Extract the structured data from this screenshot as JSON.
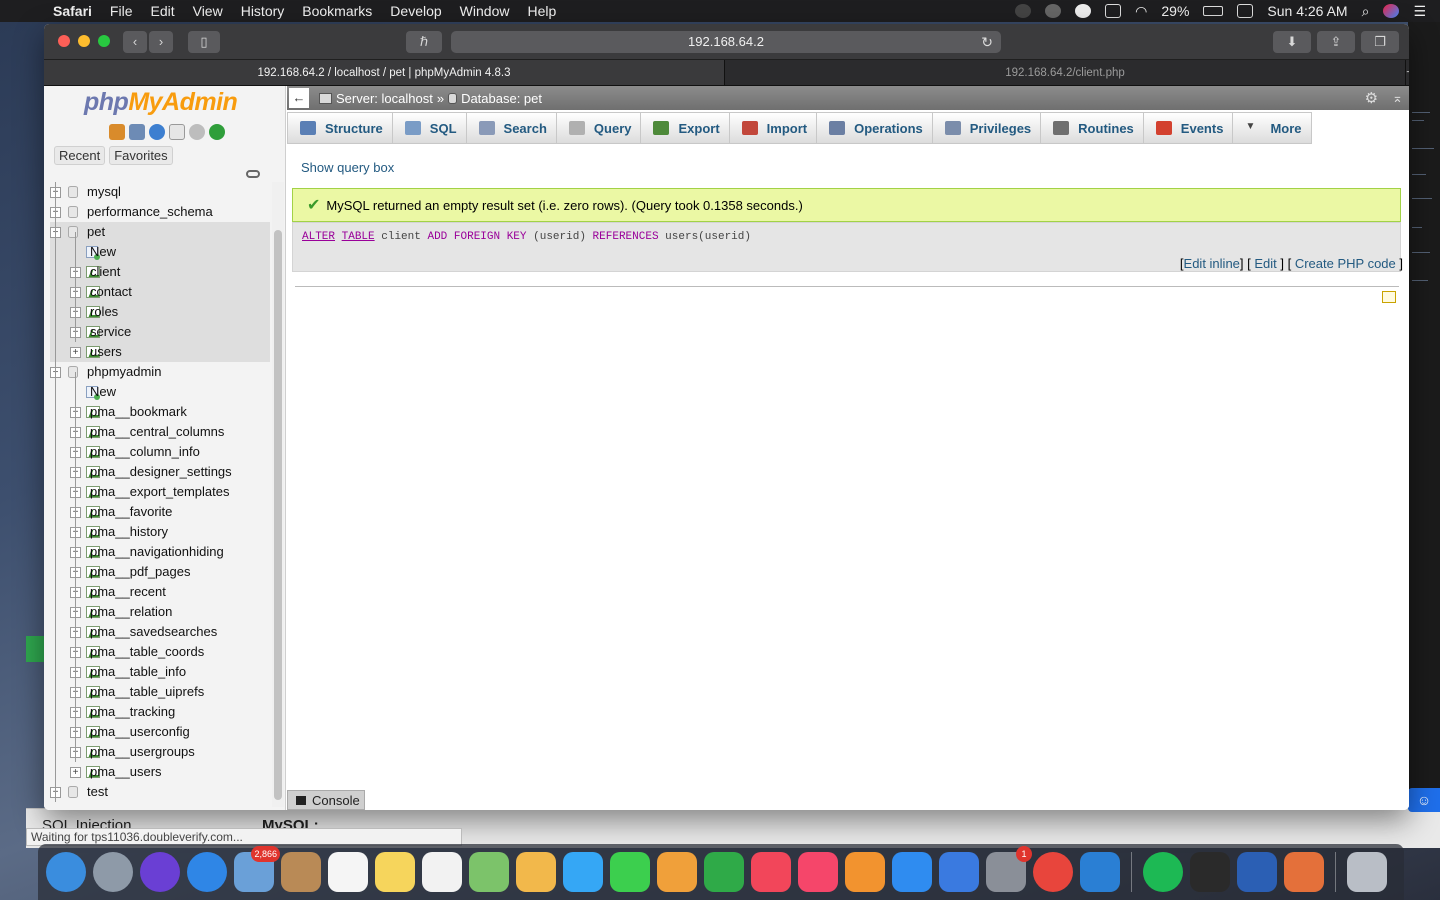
{
  "menubar": {
    "app": "Safari",
    "items": [
      "File",
      "Edit",
      "View",
      "History",
      "Bookmarks",
      "Develop",
      "Window",
      "Help"
    ],
    "battery": "29%",
    "clock": "Sun 4:26 AM"
  },
  "browser": {
    "address": "192.168.64.2",
    "tabs": [
      {
        "title": "192.168.64.2 / localhost / pet | phpMyAdmin 4.8.3",
        "active": true
      },
      {
        "title": "192.168.64.2/client.php",
        "active": false
      }
    ]
  },
  "pma": {
    "logo": {
      "php": "php",
      "myadmin": "MyAdmin"
    },
    "nav_tabs": [
      "Recent",
      "Favorites"
    ],
    "tree": [
      {
        "label": "mysql",
        "level": 0,
        "type": "db",
        "expanded": false,
        "highlight": false
      },
      {
        "label": "performance_schema",
        "level": 0,
        "type": "db",
        "expanded": false,
        "highlight": false
      },
      {
        "label": "pet",
        "level": 0,
        "type": "db",
        "expanded": true,
        "highlight": true
      },
      {
        "label": "New",
        "level": 1,
        "type": "new",
        "highlight": true
      },
      {
        "label": "client",
        "level": 1,
        "type": "table",
        "highlight": true
      },
      {
        "label": "contact",
        "level": 1,
        "type": "table",
        "highlight": true
      },
      {
        "label": "roles",
        "level": 1,
        "type": "table",
        "highlight": true
      },
      {
        "label": "service",
        "level": 1,
        "type": "table",
        "highlight": true
      },
      {
        "label": "users",
        "level": 1,
        "type": "table",
        "highlight": true
      },
      {
        "label": "phpmyadmin",
        "level": 0,
        "type": "db",
        "expanded": true,
        "highlight": false
      },
      {
        "label": "New",
        "level": 1,
        "type": "new",
        "highlight": false
      },
      {
        "label": "pma__bookmark",
        "level": 1,
        "type": "table",
        "highlight": false
      },
      {
        "label": "pma__central_columns",
        "level": 1,
        "type": "table",
        "highlight": false
      },
      {
        "label": "pma__column_info",
        "level": 1,
        "type": "table",
        "highlight": false
      },
      {
        "label": "pma__designer_settings",
        "level": 1,
        "type": "table",
        "highlight": false
      },
      {
        "label": "pma__export_templates",
        "level": 1,
        "type": "table",
        "highlight": false
      },
      {
        "label": "pma__favorite",
        "level": 1,
        "type": "table",
        "highlight": false
      },
      {
        "label": "pma__history",
        "level": 1,
        "type": "table",
        "highlight": false
      },
      {
        "label": "pma__navigationhiding",
        "level": 1,
        "type": "table",
        "highlight": false
      },
      {
        "label": "pma__pdf_pages",
        "level": 1,
        "type": "table",
        "highlight": false
      },
      {
        "label": "pma__recent",
        "level": 1,
        "type": "table",
        "highlight": false
      },
      {
        "label": "pma__relation",
        "level": 1,
        "type": "table",
        "highlight": false
      },
      {
        "label": "pma__savedsearches",
        "level": 1,
        "type": "table",
        "highlight": false
      },
      {
        "label": "pma__table_coords",
        "level": 1,
        "type": "table",
        "highlight": false
      },
      {
        "label": "pma__table_info",
        "level": 1,
        "type": "table",
        "highlight": false
      },
      {
        "label": "pma__table_uiprefs",
        "level": 1,
        "type": "table",
        "highlight": false
      },
      {
        "label": "pma__tracking",
        "level": 1,
        "type": "table",
        "highlight": false
      },
      {
        "label": "pma__userconfig",
        "level": 1,
        "type": "table",
        "highlight": false
      },
      {
        "label": "pma__usergroups",
        "level": 1,
        "type": "table",
        "highlight": false
      },
      {
        "label": "pma__users",
        "level": 1,
        "type": "table",
        "highlight": false
      },
      {
        "label": "test",
        "level": 0,
        "type": "db",
        "expanded": false,
        "highlight": false
      }
    ],
    "breadcrumb": {
      "server": "Server: localhost",
      "sep": "»",
      "database": "Database: pet"
    },
    "menu": [
      {
        "label": "Structure",
        "icon": "structure-icon",
        "color": "#5a7fb5"
      },
      {
        "label": "SQL",
        "icon": "sql-icon",
        "color": "#7a9cc6"
      },
      {
        "label": "Search",
        "icon": "search-icon",
        "color": "#8a9ab8"
      },
      {
        "label": "Query",
        "icon": "query-icon",
        "color": "#b0b0b0"
      },
      {
        "label": "Export",
        "icon": "export-icon",
        "color": "#4e8a3a"
      },
      {
        "label": "Import",
        "icon": "import-icon",
        "color": "#c2473b"
      },
      {
        "label": "Operations",
        "icon": "wrench-icon",
        "color": "#6b7fa3"
      },
      {
        "label": "Privileges",
        "icon": "privileges-icon",
        "color": "#7b8dab"
      },
      {
        "label": "Routines",
        "icon": "routines-icon",
        "color": "#6f6f6f"
      },
      {
        "label": "Events",
        "icon": "events-icon",
        "color": "#d3412f"
      },
      {
        "label": "More",
        "icon": "triangle-down-icon",
        "color": "#444444"
      }
    ],
    "show_query": "Show query box",
    "success_message": "MySQL returned an empty result set (i.e. zero rows). (Query took 0.1358 seconds.)",
    "sql": {
      "alter": "ALTER",
      "table": "TABLE",
      "name": "client",
      "add": "ADD",
      "foreign_key": "FOREIGN KEY",
      "col": "(userid)",
      "references": "REFERENCES",
      "ref": "users(userid)"
    },
    "sql_links": {
      "edit_inline": "Edit inline",
      "edit": "Edit",
      "create_php": "Create PHP code"
    },
    "console": "Console"
  },
  "status": "Waiting for tps11036.doubleverify.com...",
  "background": {
    "left_text": "SQL Injection",
    "right_text": "MySQL:"
  },
  "dock": {
    "apps": [
      {
        "name": "finder-icon",
        "color": "#3a8dde"
      },
      {
        "name": "launchpad-icon",
        "color": "#8e9aa8"
      },
      {
        "name": "siri-icon",
        "color": "#6a3fd4"
      },
      {
        "name": "safari-icon",
        "color": "#2f86e6"
      },
      {
        "name": "mail-stamp-icon",
        "color": "#6aa0d8",
        "badge": "2,866"
      },
      {
        "name": "contacts-icon",
        "color": "#b98a56"
      },
      {
        "name": "calendar-icon",
        "color": "#f5f5f5"
      },
      {
        "name": "notes-icon",
        "color": "#f6d55c"
      },
      {
        "name": "reminders-icon",
        "color": "#f2f2f2"
      },
      {
        "name": "maps-icon",
        "color": "#7cc36a"
      },
      {
        "name": "photos-icon",
        "color": "#f2b84b"
      },
      {
        "name": "messages-icon",
        "color": "#35a7f5"
      },
      {
        "name": "facetime-icon",
        "color": "#3ccf4e"
      },
      {
        "name": "pages-icon",
        "color": "#f0a03a"
      },
      {
        "name": "numbers-icon",
        "color": "#2faa48"
      },
      {
        "name": "news-icon",
        "color": "#f2465a"
      },
      {
        "name": "music-icon",
        "color": "#f5466a"
      },
      {
        "name": "books-icon",
        "color": "#f2932f"
      },
      {
        "name": "app-store-icon",
        "color": "#2f8cf0"
      },
      {
        "name": "keynote-icon",
        "color": "#3a7ae0"
      },
      {
        "name": "system-preferences-icon",
        "color": "#8a8f98",
        "badge": "1"
      },
      {
        "name": "chrome-icon",
        "color": "#e8453c"
      },
      {
        "name": "vscode-icon",
        "color": "#2a7fd4"
      },
      {
        "name": "spotify-icon",
        "color": "#1db954"
      },
      {
        "name": "terminal-icon",
        "color": "#2a2a2a"
      },
      {
        "name": "word-icon",
        "color": "#2b5fb4"
      },
      {
        "name": "xampp-icon",
        "color": "#e4703a"
      },
      {
        "name": "trash-icon",
        "color": "#b9bec6"
      }
    ]
  }
}
